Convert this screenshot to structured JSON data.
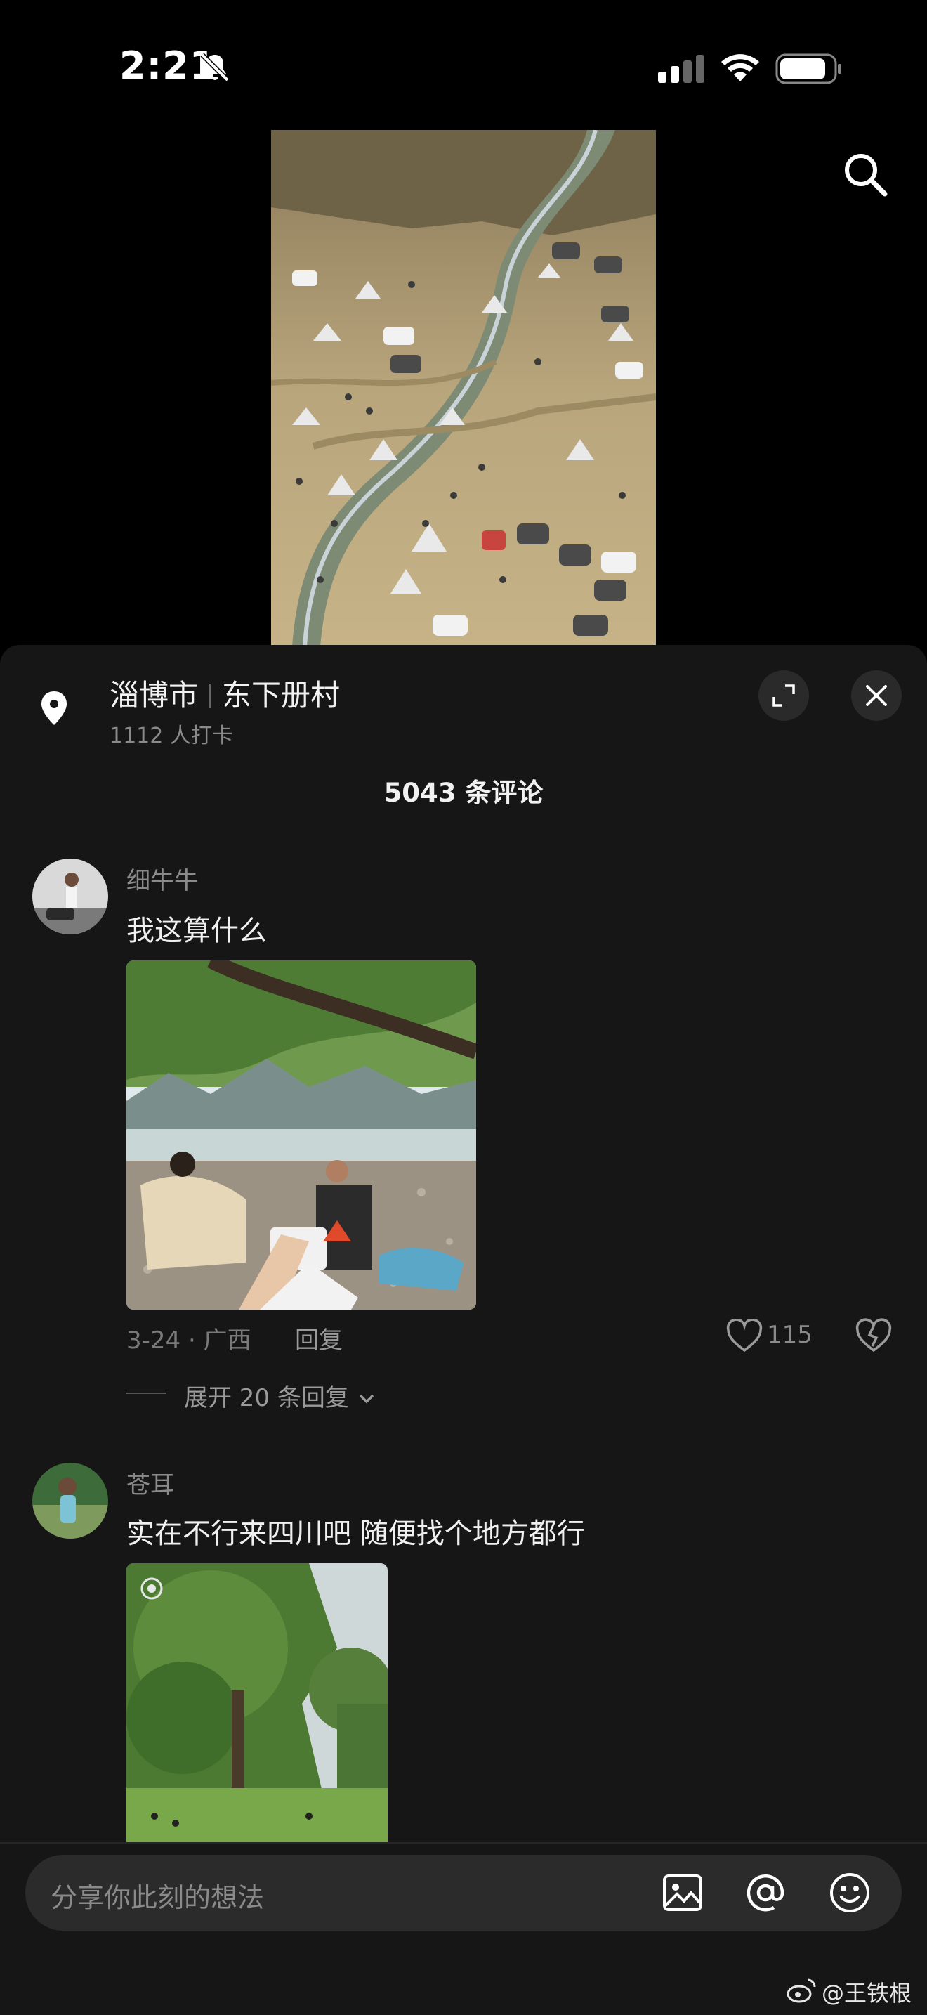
{
  "status_bar": {
    "time": "2:21"
  },
  "location": {
    "city": "淄博市",
    "place": "东下册村",
    "checkins": "1112 人打卡"
  },
  "comments_header": "5043 条评论",
  "comments": [
    {
      "user": "细牛牛",
      "text": "我这算什么",
      "date": "3-24 · 广西",
      "reply_label": "回复",
      "likes": "115",
      "expand_label": "展开 20 条回复"
    },
    {
      "user": "苍耳",
      "text": "实在不行来四川吧 随便找个地方都行"
    }
  ],
  "input": {
    "placeholder": "分享你此刻的想法"
  },
  "watermark": "@王铁根",
  "colors": {
    "background": "#000000",
    "sheet": "#161616",
    "input": "#2b2b2b",
    "text_secondary": "#8a8a8a"
  },
  "icons": [
    "bell-slash-icon",
    "signal-icon",
    "wifi-icon",
    "battery-icon",
    "search-icon",
    "location-pin-icon",
    "expand-icon",
    "close-icon",
    "heart-icon",
    "broken-heart-icon",
    "chevron-down-icon",
    "image-icon",
    "at-icon",
    "emoji-icon",
    "weibo-icon"
  ]
}
